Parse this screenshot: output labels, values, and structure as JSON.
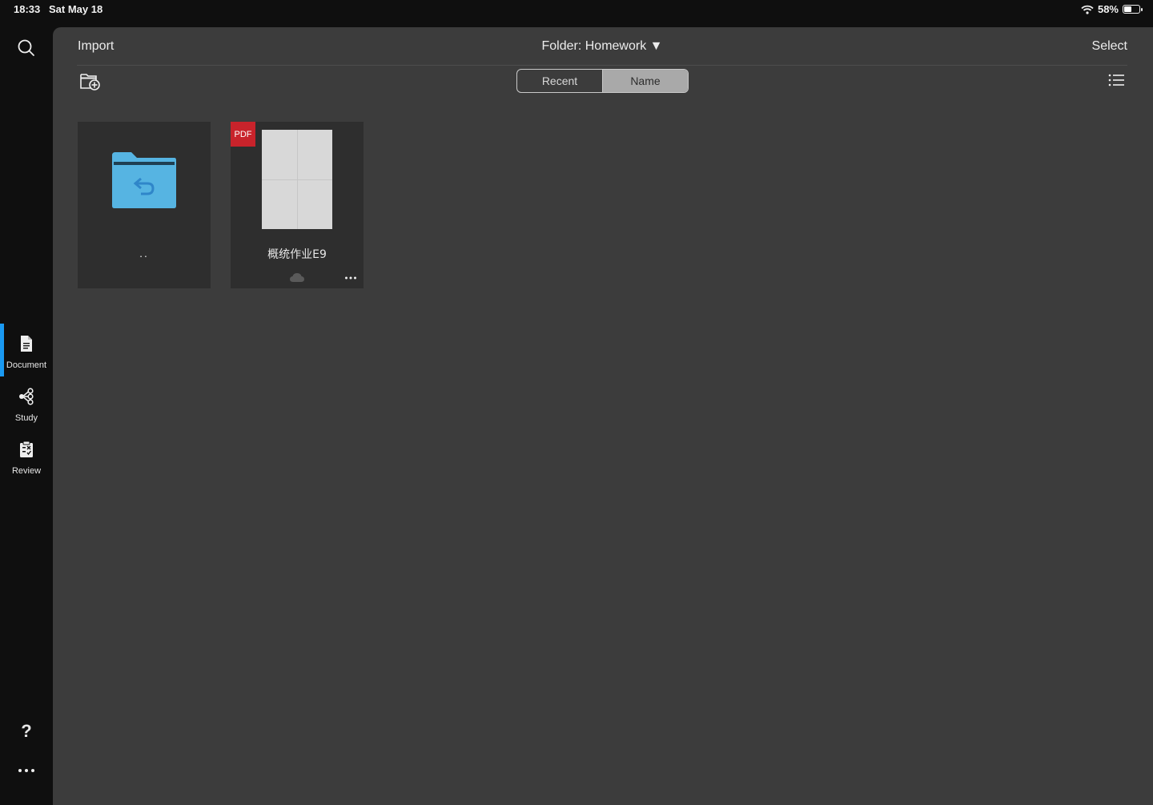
{
  "status_bar": {
    "time": "18:33",
    "date": "Sat May 18",
    "battery_percent": "58%",
    "battery_level": 0.58
  },
  "sidebar": {
    "items": [
      {
        "label": "Document",
        "icon": "document-icon",
        "active": true
      },
      {
        "label": "Study",
        "icon": "study-share-icon",
        "active": false
      },
      {
        "label": "Review",
        "icon": "review-clipboard-icon",
        "active": false
      }
    ],
    "help_label": "?"
  },
  "toolbar": {
    "import_label": "Import",
    "folder_title": "Folder: Homework ▼",
    "select_label": "Select"
  },
  "sort": {
    "options": [
      "Recent",
      "Name"
    ],
    "selected": "Name"
  },
  "files": [
    {
      "type": "parent-folder",
      "name": ".."
    },
    {
      "type": "pdf",
      "badge": "PDF",
      "name": "概统作业E9"
    }
  ],
  "colors": {
    "accent": "#1a9af2",
    "folder": "#56b4e2",
    "pdf_badge": "#c8232b",
    "panel": "#3c3c3c"
  }
}
